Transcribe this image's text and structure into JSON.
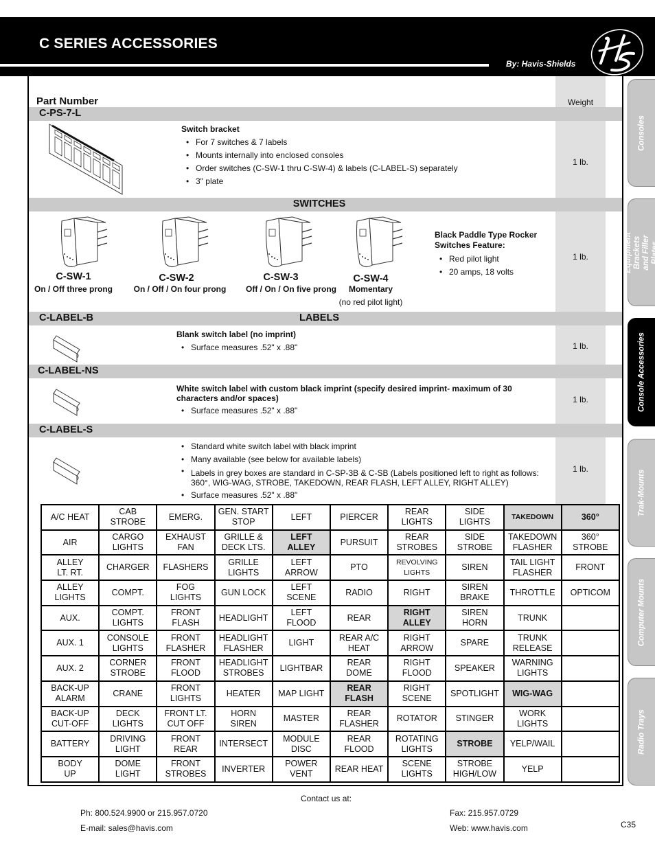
{
  "header": {
    "title": "C SERIES ACCESSORIES",
    "byline": "By: Havis-Shields",
    "logo_text": "HS"
  },
  "columns": {
    "part_number": "Part Number",
    "weight": "Weight"
  },
  "products": {
    "bracket": {
      "part": "C-PS-7-L",
      "title": "Switch bracket",
      "bullets": [
        "For 7 switches & 7 labels",
        "Mounts internally into enclosed consoles",
        "Order switches (C-SW-1 thru C-SW-4) & labels (C-LABEL-S) separately",
        "3\" plate"
      ],
      "weight": "1 lb."
    },
    "switches": {
      "section": "SWITCHES",
      "items": [
        {
          "part": "C-SW-1",
          "desc": "On / Off three prong",
          "note": ""
        },
        {
          "part": "C-SW-2",
          "desc": "On / Off / On four prong",
          "note": ""
        },
        {
          "part": "C-SW-3",
          "desc": "Off / On / On five prong",
          "note": ""
        },
        {
          "part": "C-SW-4",
          "desc": "Momentary",
          "note": "(no red pilot light)"
        }
      ],
      "feature_title": "Black Paddle Type Rocker Switches Feature:",
      "bullets": [
        "Red pilot light",
        "20 amps, 18 volts"
      ],
      "weight": "1 lb."
    },
    "labels_section": "LABELS",
    "label_b": {
      "part": "C-LABEL-B",
      "title": "Blank switch label (no imprint)",
      "bullets": [
        "Surface measures .52\" x .88\""
      ],
      "weight": "1 lb."
    },
    "label_ns": {
      "part": "C-LABEL-NS",
      "title": "White switch label with custom black imprint (specify desired imprint- maximum of 30 characters and/or spaces)",
      "bullets": [
        "Surface measures .52\" x .88\""
      ],
      "weight": "1 lb."
    },
    "label_s": {
      "part": "C-LABEL-S",
      "bullets": [
        "Standard white switch label with black imprint",
        "Many available (see below for available labels)",
        "Labels in grey boxes are standard in C-SP-3B & C-SB (Labels positioned left to right as follows: 360°, WIG-WAG, STROBE, TAKEDOWN, REAR FLASH, LEFT ALLEY, RIGHT ALLEY)",
        "Surface measures .52\" x .88\""
      ],
      "weight": "1 lb."
    }
  },
  "label_table": {
    "rows": [
      [
        "A/C HEAT",
        "CAB\nSTROBE",
        "EMERG.",
        "GEN. START\nSTOP",
        "LEFT",
        "PIERCER",
        "REAR\nLIGHTS",
        "SIDE\nLIGHTS",
        "TAKEDOWN",
        "360°"
      ],
      [
        "AIR",
        "CARGO\nLIGHTS",
        "EXHAUST\nFAN",
        "GRILLE &\nDECK LTS.",
        "LEFT\nALLEY",
        "PURSUIT",
        "REAR\nSTROBES",
        "SIDE\nSTROBE",
        "TAKEDOWN\nFLASHER",
        "360°\nSTROBE"
      ],
      [
        "ALLEY\nLT.      RT.",
        "CHARGER",
        "FLASHERS",
        "GRILLE\nLIGHTS",
        "LEFT\nARROW",
        "PTO",
        "REVOLVING\nLIGHTS",
        "SIREN",
        "TAIL LIGHT\nFLASHER",
        "FRONT"
      ],
      [
        "ALLEY\nLIGHTS",
        "COMPT.",
        "FOG\nLIGHTS",
        "GUN LOCK",
        "LEFT\nSCENE",
        "RADIO",
        "RIGHT",
        "SIREN\nBRAKE",
        "THROTTLE",
        "OPTICOM"
      ],
      [
        "AUX.",
        "COMPT.\nLIGHTS",
        "FRONT\nFLASH",
        "HEADLIGHT",
        "LEFT\nFLOOD",
        "REAR",
        "RIGHT\nALLEY",
        "SIREN\nHORN",
        "TRUNK",
        ""
      ],
      [
        "AUX. 1",
        "CONSOLE\nLIGHTS",
        "FRONT\nFLASHER",
        "HEADLIGHT\nFLASHER",
        "LIGHT",
        "REAR A/C\nHEAT",
        "RIGHT\nARROW",
        "SPARE",
        "TRUNK\nRELEASE",
        ""
      ],
      [
        "AUX. 2",
        "CORNER\nSTROBE",
        "FRONT\nFLOOD",
        "HEADLIGHT\nSTROBES",
        "LIGHTBAR",
        "REAR\nDOME",
        "RIGHT\nFLOOD",
        "SPEAKER",
        "WARNING\nLIGHTS",
        ""
      ],
      [
        "BACK-UP\nALARM",
        "CRANE",
        "FRONT\nLIGHTS",
        "HEATER",
        "MAP LIGHT",
        "REAR\nFLASH",
        "RIGHT\nSCENE",
        "SPOTLIGHT",
        "WIG-WAG",
        ""
      ],
      [
        "BACK-UP\nCUT-OFF",
        "DECK\nLIGHTS",
        "FRONT LT.\nCUT OFF",
        "HORN\nSIREN",
        "MASTER",
        "REAR\nFLASHER",
        "ROTATOR",
        "STINGER",
        "WORK\nLIGHTS",
        ""
      ],
      [
        "BATTERY",
        "DRIVING\nLIGHT",
        "FRONT\nREAR",
        "INTERSECT",
        "MODULE\nDISC",
        "REAR\nFLOOD",
        "ROTATING\nLIGHTS",
        "STROBE",
        "YELP/WAIL",
        ""
      ],
      [
        "BODY\nUP",
        "DOME\nLIGHT",
        "FRONT\nSTROBES",
        "INVERTER",
        "POWER\nVENT",
        "REAR HEAT",
        "SCENE\nLIGHTS",
        "STROBE\nHIGH/LOW",
        "YELP",
        ""
      ]
    ],
    "grey_cells": [
      "0-8",
      "0-9",
      "1-4",
      "4-6",
      "7-5",
      "7-8",
      "9-7"
    ],
    "small_cells": [
      "0-8",
      "2-6"
    ],
    "highlight_color": "#d6d6d6"
  },
  "side_tabs": [
    {
      "label": "Consoles",
      "active": false
    },
    {
      "label": "Equipment Brackets\nand Filler Plates",
      "active": false
    },
    {
      "label": "Console Accessories",
      "active": true
    },
    {
      "label": "Trak-Mounts",
      "active": false
    },
    {
      "label": "Computer Mounts",
      "active": false
    },
    {
      "label": "Radio Trays",
      "active": false
    }
  ],
  "footer": {
    "contact": "Contact us at:",
    "phone": "Ph: 800.524.9900 or 215.957.0720",
    "email": "E-mail: sales@havis.com",
    "fax": "Fax: 215.957.0729",
    "web": "Web: www.havis.com",
    "page": "C35"
  }
}
